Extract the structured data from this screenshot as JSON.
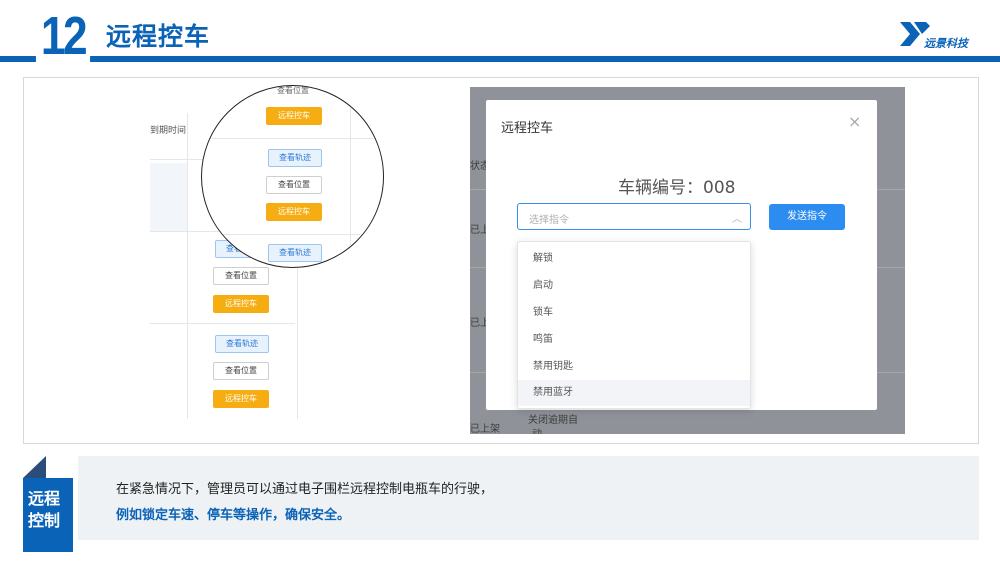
{
  "header": {
    "number": "12",
    "title": "远程控车",
    "logo_text": "远景科技",
    "accent_color": "#0b63b7"
  },
  "left_panel": {
    "column_header": "到期时间",
    "buttons": {
      "track": "查看轨迹",
      "position": "查看位置",
      "remote": "远程控车"
    }
  },
  "zoom_panel": {
    "top_label": "查看位置",
    "buttons": {
      "track": "查看轨迹",
      "position": "查看位置",
      "remote": "远程控车"
    }
  },
  "dialog": {
    "title": "远程控车",
    "close_icon": "close-icon",
    "vehicle_label": "车辆编号：008",
    "select_placeholder": "选择指令",
    "send_button": "发送指令",
    "options": [
      "解锁",
      "启动",
      "锁车",
      "鸣笛",
      "禁用钥匙",
      "禁用蓝牙"
    ],
    "highlighted_option": "禁用蓝牙",
    "button_color": "#2d8cf0"
  },
  "background_table": {
    "status_fragment": "状态",
    "shelf_fragment_1": "已上",
    "shelf_fragment_2": "已上",
    "shelf_fragment_3": "已上架",
    "close_fragment": "关闭逾期自",
    "close_fragment_2": "动"
  },
  "callout": {
    "tag": "远程\n控制",
    "line1": "在紧急情况下，管理员可以通过电子围栏远程控制电瓶车的行驶，",
    "line2": "例如锁定车速、停车等操作，确保安全。"
  }
}
